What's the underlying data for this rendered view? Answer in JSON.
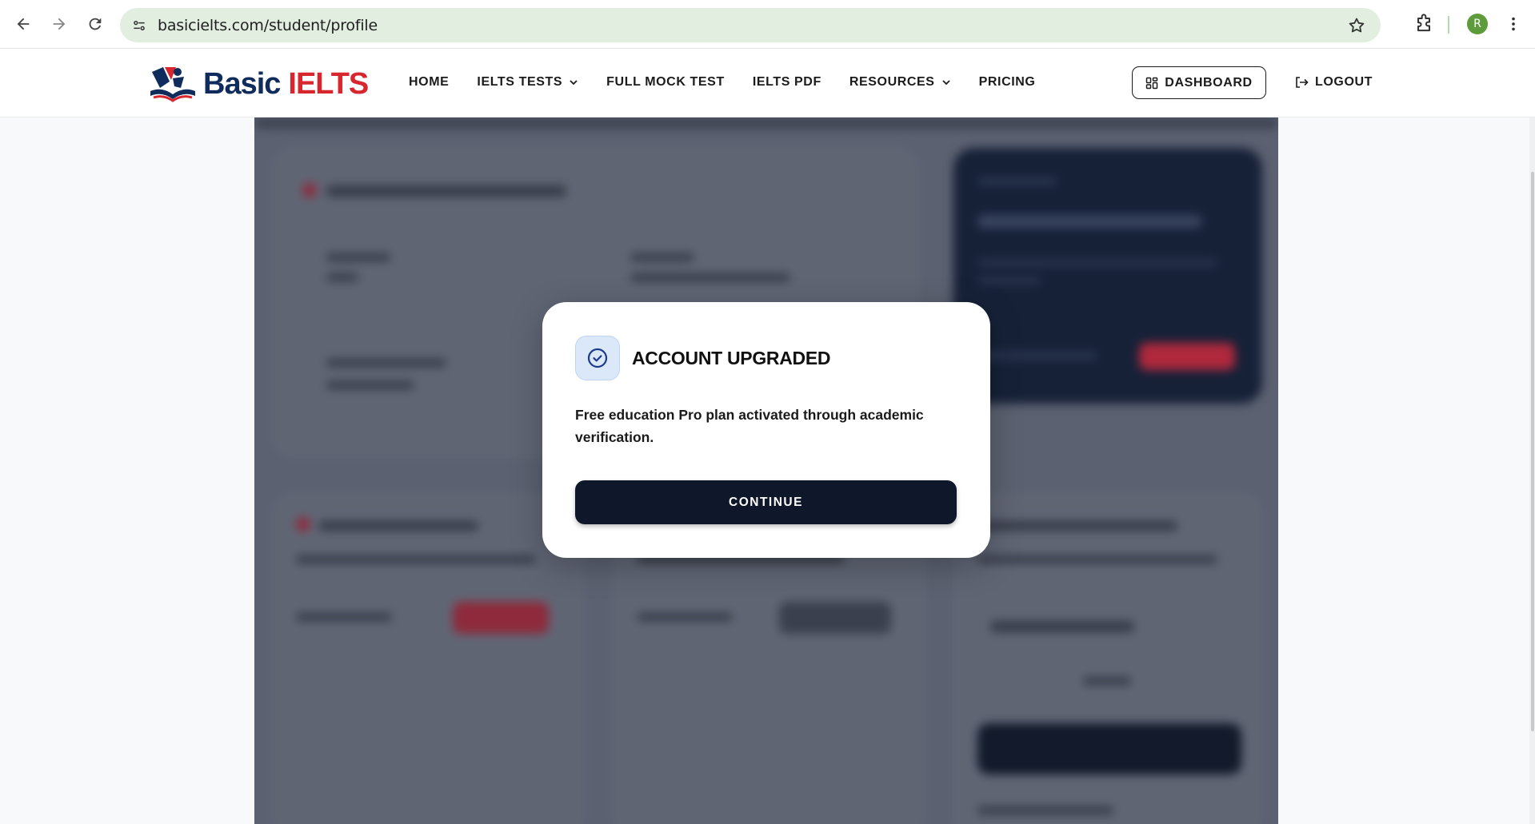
{
  "browser": {
    "url": "basicielts.com/student/profile",
    "profile_initial": "R"
  },
  "site": {
    "logo_word_1": "Basic",
    "logo_word_2": "IELTS",
    "nav": [
      {
        "label": "HOME",
        "has_dropdown": false
      },
      {
        "label": "IELTS TESTS",
        "has_dropdown": true
      },
      {
        "label": "FULL MOCK TEST",
        "has_dropdown": false
      },
      {
        "label": "IELTS PDF",
        "has_dropdown": false
      },
      {
        "label": "RESOURCES",
        "has_dropdown": true
      },
      {
        "label": "PRICING",
        "has_dropdown": false
      }
    ],
    "dashboard_label": "DASHBOARD",
    "logout_label": "LOGOUT"
  },
  "modal": {
    "title": "ACCOUNT UPGRADED",
    "message": "Free education Pro plan activated through academic verification.",
    "continue_label": "CONTINUE",
    "icon": "check-circle-icon"
  },
  "colors": {
    "brand_navy": "#0f2c5c",
    "brand_red": "#d7262d",
    "overlay": "#5b6170",
    "button_dark": "#0f172a",
    "omnibox_bg": "#e2efe0"
  }
}
